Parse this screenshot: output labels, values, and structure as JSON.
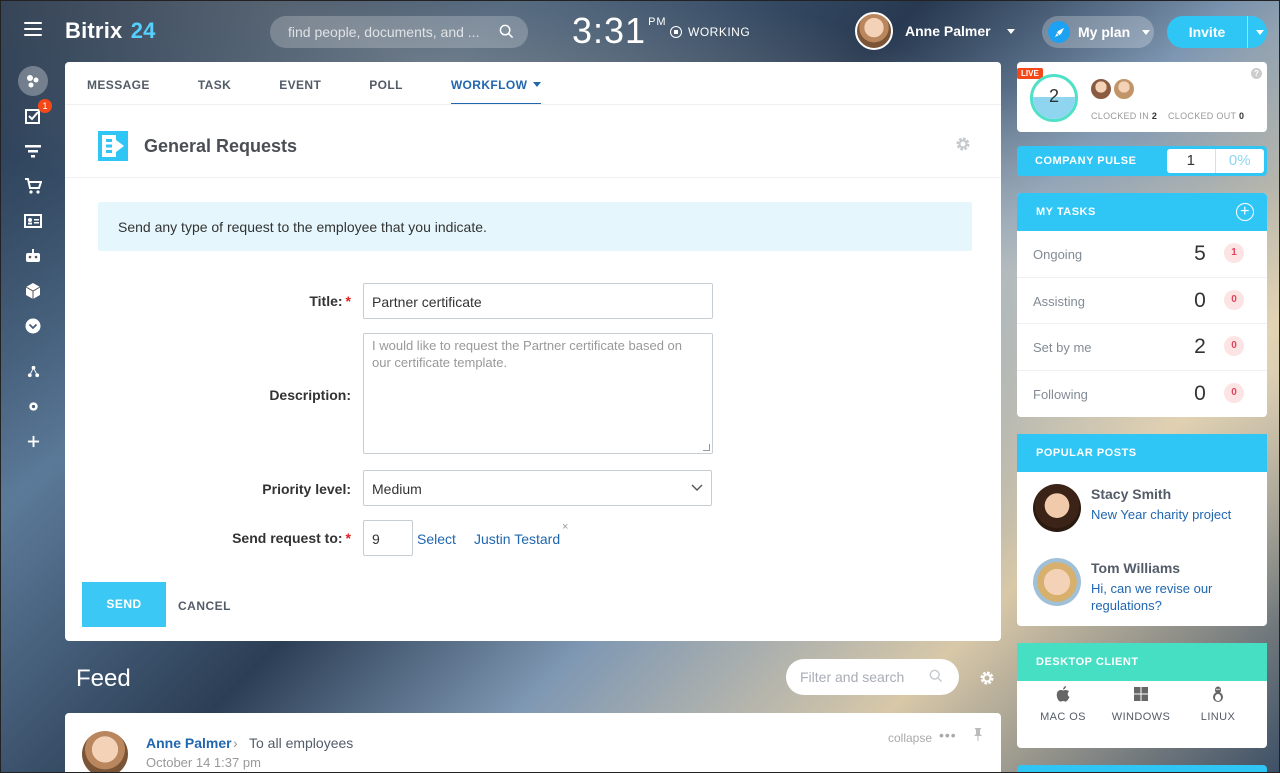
{
  "header": {
    "logo_text": "Bitrix",
    "logo_num": "24",
    "search_placeholder": "find people, documents, and ...",
    "clock_time": "3:31",
    "clock_ampm": "PM",
    "work_status": "WORKING",
    "user_name": "Anne Palmer",
    "plan_label": "My plan",
    "invite_label": "Invite"
  },
  "leftnav": {
    "tasks_badge": "1",
    "icons": [
      "network-icon",
      "tasks-icon",
      "filter-icon",
      "cart-icon",
      "contact-card-icon",
      "robot-icon",
      "box-icon",
      "more-icon",
      "structure-icon",
      "settings-icon",
      "add-icon"
    ]
  },
  "composer": {
    "tabs": [
      {
        "label": "MESSAGE"
      },
      {
        "label": "TASK"
      },
      {
        "label": "EVENT"
      },
      {
        "label": "POLL"
      },
      {
        "label": "WORKFLOW"
      }
    ],
    "active_tab": "WORKFLOW",
    "workflow_title": "General Requests",
    "info_text": "Send any type of request to the employee that you indicate.",
    "fields": {
      "title_label": "Title:",
      "title_value": "Partner certificate",
      "description_label": "Description:",
      "description_placeholder": "I would like to request the Partner certificate based on our certificate template.",
      "priority_label": "Priority level:",
      "priority_value": "Medium",
      "send_to_label": "Send request to:",
      "send_to_value": "9",
      "select_link": "Select",
      "recipient": "Justin Testard",
      "remove_symbol": "×"
    },
    "required_mark": "*",
    "send_label": "SEND",
    "cancel_label": "CANCEL"
  },
  "feed": {
    "title": "Feed",
    "search_placeholder": "Filter and search",
    "post": {
      "author": "Anne Palmer",
      "arrow": "›",
      "audience": "To all employees",
      "date": "October 14 1:37 pm",
      "collapse_label": "collapse",
      "more_symbol": "•••"
    }
  },
  "widgets": {
    "live_badge": "LIVE",
    "clocked_count": "2",
    "clocked_in_label": "CLOCKED IN",
    "clocked_in_value": "2",
    "clocked_out_label": "CLOCKED OUT",
    "clocked_out_value": "0",
    "help_symbol": "?",
    "pulse_label": "COMPANY PULSE",
    "pulse_value": "1",
    "pulse_percent": "0%",
    "tasks_title": "MY TASKS",
    "tasks": [
      {
        "name": "Ongoing",
        "count": "5",
        "badge": "1"
      },
      {
        "name": "Assisting",
        "count": "0",
        "badge": "0"
      },
      {
        "name": "Set by me",
        "count": "2",
        "badge": "0"
      },
      {
        "name": "Following",
        "count": "0",
        "badge": "0"
      }
    ],
    "posts_title": "POPULAR POSTS",
    "popular_posts": [
      {
        "name": "Stacy Smith",
        "text": "New Year charity project"
      },
      {
        "name": "Tom Williams",
        "text": "Hi, can we revise our regulations?"
      }
    ],
    "desktop_title": "DESKTOP CLIENT",
    "desktop_clients": [
      {
        "label": "MAC OS",
        "icon": "apple-icon"
      },
      {
        "label": "WINDOWS",
        "icon": "windows-icon"
      },
      {
        "label": "LINUX",
        "icon": "linux-icon"
      }
    ]
  },
  "colors": {
    "accent": "#2fc6f6",
    "link": "#2067b0",
    "desktop_header": "#47dfc4",
    "badge": "#f54819"
  }
}
